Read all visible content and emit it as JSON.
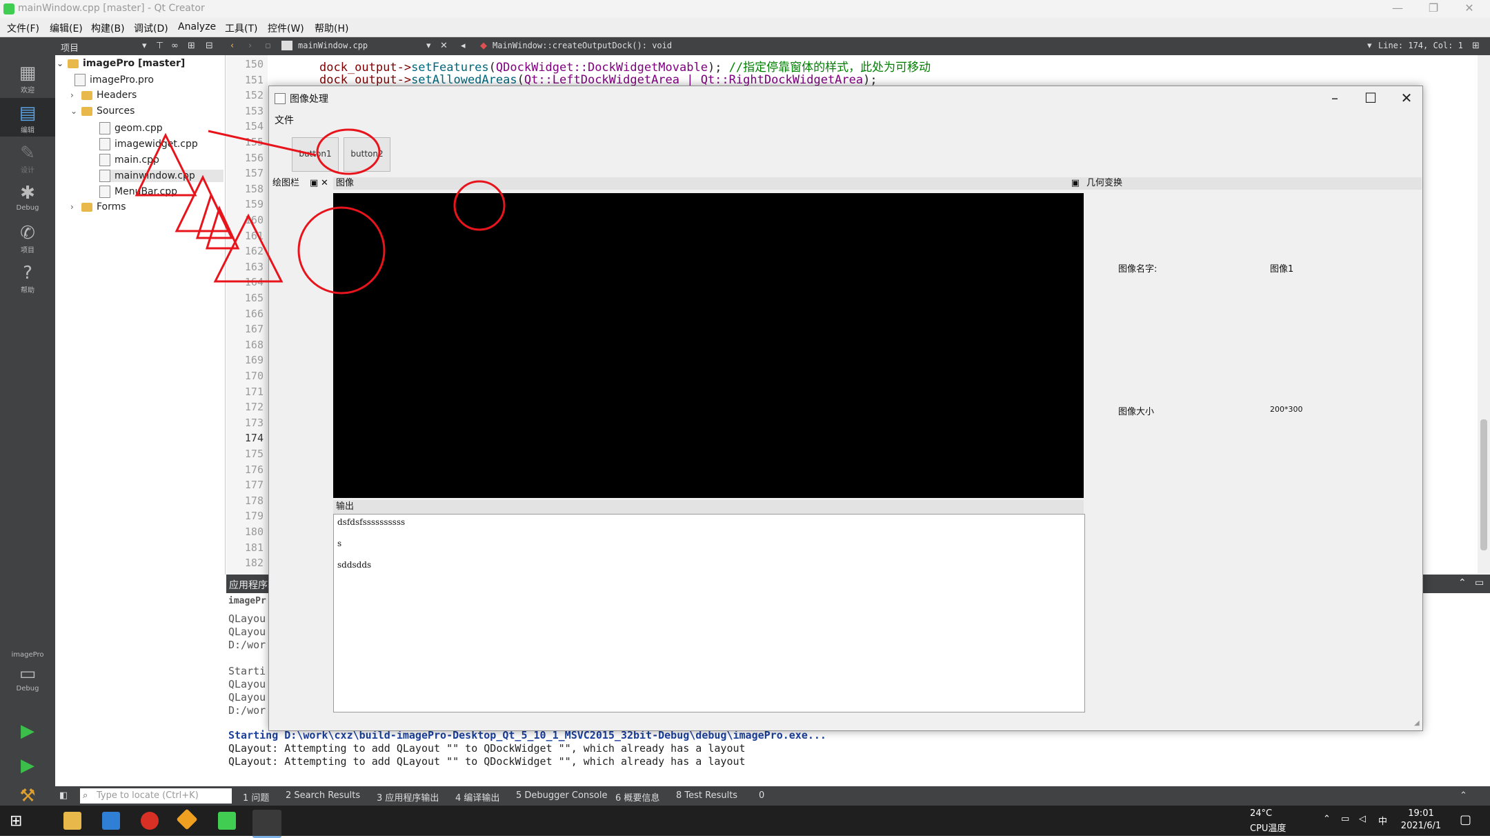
{
  "window": {
    "title": "mainWindow.cpp [master] - Qt Creator",
    "controls": [
      "—",
      "❐",
      "✕"
    ]
  },
  "menubar": [
    "文件(F)",
    "编辑(E)",
    "构建(B)",
    "调试(D)",
    "Analyze",
    "工具(T)",
    "控件(W)",
    "帮助(H)"
  ],
  "toolbar": {
    "panel_label": "项目",
    "file_name": "mainWindow.cpp",
    "symbol": "MainWindow::createOutputDock(): void",
    "cursor": "Line: 174, Col: 1"
  },
  "modes": [
    {
      "label": "欢迎",
      "icon": "grid-icon"
    },
    {
      "label": "编辑",
      "icon": "edit-icon"
    },
    {
      "label": "设计",
      "icon": "design-icon"
    },
    {
      "label": "Debug",
      "icon": "bug-icon"
    },
    {
      "label": "项目",
      "icon": "wrench-icon"
    },
    {
      "label": "帮助",
      "icon": "help-icon"
    }
  ],
  "kit": {
    "project": "imagePro",
    "config": "Debug"
  },
  "tree": {
    "root": "imagePro [master]",
    "items": [
      "imagePro.pro",
      "Headers",
      "Sources",
      "geom.cpp",
      "imagewidget.cpp",
      "main.cpp",
      "mainwindow.cpp",
      "MenuBar.cpp",
      "Forms"
    ]
  },
  "editor": {
    "line_numbers": [
      "150",
      "151",
      "152",
      "153",
      "154",
      "155",
      "156",
      "157",
      "158",
      "159",
      "160",
      "161",
      "162",
      "163",
      "164",
      "165",
      "166",
      "167",
      "168",
      "169",
      "170",
      "171",
      "172",
      "173",
      "174",
      "175",
      "176",
      "177",
      "178",
      "179",
      "180",
      "181",
      "182"
    ],
    "code": {
      "l150_obj": "dock_output->",
      "l150_fn": "setFeatures",
      "l150_arg": "QDockWidget::DockWidgetMovable",
      "l150_end": ");",
      "l150_comment": "//指定停靠窗体的样式，此处为可移动",
      "l151_obj": "dock_output->",
      "l151_fn": "setAllowedAreas",
      "l151_arg": "Qt::LeftDockWidgetArea | Qt::RightDockWidgetArea",
      "l151_end": ");"
    }
  },
  "output_pane": {
    "title": "应用程序输出",
    "tab": "imagePr",
    "lines": [
      "QLayou",
      "QLayou",
      "D:/wor",
      "",
      "Starti",
      "QLayou",
      "QLayou",
      "D:/wor"
    ],
    "starting": "Starting D:\\work\\cxz\\build-imagePro-Desktop_Qt_5_10_1_MSVC2015_32bit-Debug\\debug\\imagePro.exe...",
    "log1": "QLayout: Attempting to add QLayout \"\" to QDockWidget \"\", which already has a layout",
    "log2": "QLayout: Attempting to add QLayout \"\" to QDockWidget \"\", which already has a layout"
  },
  "statusbar": {
    "locator_placeholder": "Type to locate (Ctrl+K)",
    "tabs": [
      "1 问题",
      "2 Search Results",
      "3 应用程序输出",
      "4 编译输出",
      "5 Debugger Console",
      "6 概要信息",
      "8 Test Results",
      "0"
    ]
  },
  "app": {
    "title": "图像处理",
    "menu": "文件",
    "button1": "button1",
    "button2": "button2",
    "dock_left": "绘图栏",
    "dock_image": "图像",
    "dock_geo": "几何变换",
    "output_title": "输出",
    "output_lines": [
      "dsfdsfssssssssss",
      "s",
      "sddsdds"
    ],
    "image_name_label": "图像名字:",
    "image_name_value": "图像1",
    "image_size_label": "图像大小",
    "image_size_value": "200*300"
  },
  "taskbar": {
    "temp": "24°C",
    "cpu": "CPU温度",
    "ime": "中",
    "time": "19:01",
    "date": "2021/6/1"
  },
  "annotation_color": "#e8141c"
}
